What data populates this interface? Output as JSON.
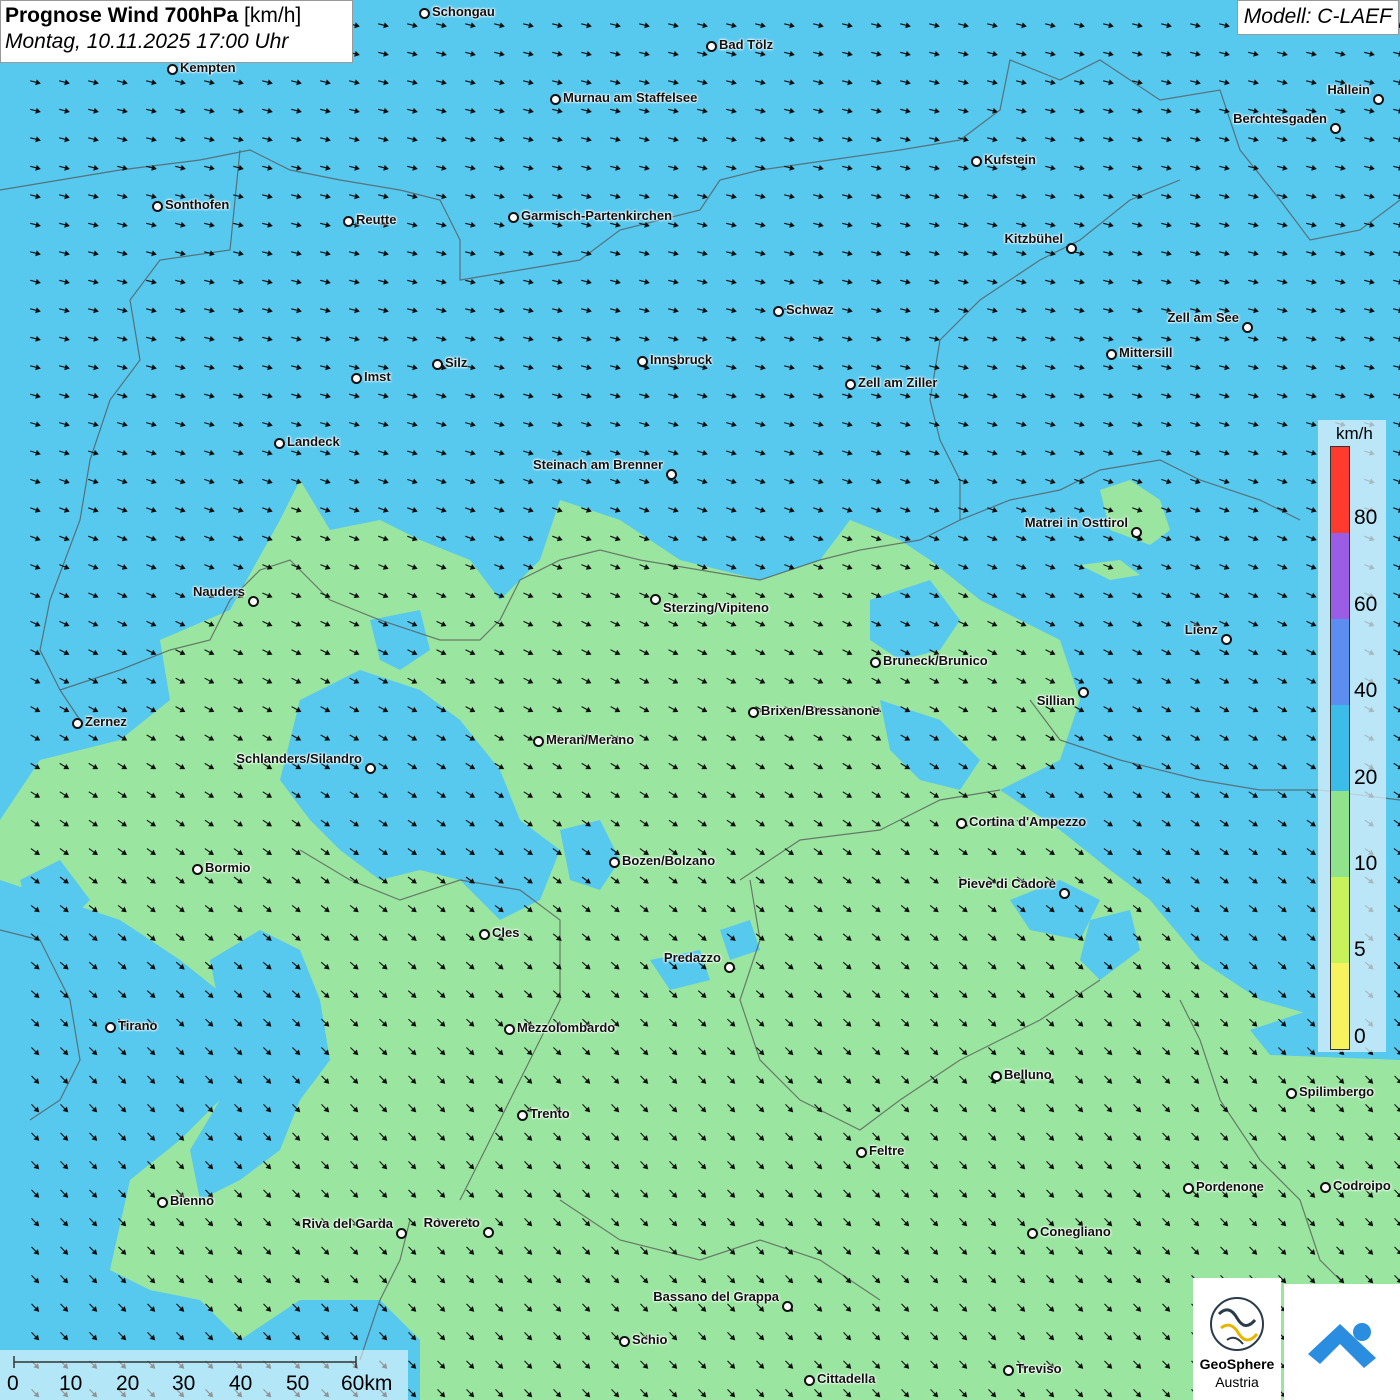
{
  "title": {
    "main_bold": "Prognose Wind 700hPa",
    "main_unit": " [km/h]",
    "subtitle": "Montag, 10.11.2025 17:00 Uhr"
  },
  "model_label": "Modell: C-LAEF",
  "legend": {
    "unit": "km/h",
    "labels": [
      "80",
      "60",
      "40",
      "20",
      "10",
      "5",
      "0"
    ],
    "colors": [
      "#ff3b30",
      "#9b5de5",
      "#5b8ef0",
      "#3cbce8",
      "#8fe38a",
      "#c8f25a",
      "#f6f35e"
    ]
  },
  "scale_bar": {
    "labels": [
      "0",
      "10",
      "20",
      "30",
      "40",
      "50",
      "60km"
    ]
  },
  "logos": {
    "geosphere_line1": "GeoSphere",
    "geosphere_line2": "Austria"
  },
  "field_colors": {
    "strong": "#57c8ee",
    "weak": "#9ae6a0",
    "border": "#555"
  },
  "cities": [
    {
      "name": "Schongau"
    },
    {
      "name": "Bad Tölz"
    },
    {
      "name": "Kempten"
    },
    {
      "name": "Murnau am Staffelsee"
    },
    {
      "name": "Hallein"
    },
    {
      "name": "Berchtesgaden"
    },
    {
      "name": "Kufstein"
    },
    {
      "name": "Sonthofen"
    },
    {
      "name": "Reutte"
    },
    {
      "name": "Garmisch-Partenkirchen"
    },
    {
      "name": "Kitzbühel"
    },
    {
      "name": "Schwaz"
    },
    {
      "name": "Zell am See"
    },
    {
      "name": "Mittersill"
    },
    {
      "name": "Innsbruck"
    },
    {
      "name": "Silz"
    },
    {
      "name": "Imst"
    },
    {
      "name": "Zell am Ziller"
    },
    {
      "name": "Landeck"
    },
    {
      "name": "Steinach am Brenner"
    },
    {
      "name": "Matrei in Osttirol"
    },
    {
      "name": "Nauders"
    },
    {
      "name": "Sterzing/Vipiteno"
    },
    {
      "name": "Lienz"
    },
    {
      "name": "Bruneck/Brunico"
    },
    {
      "name": "Sillian"
    },
    {
      "name": "Zernez"
    },
    {
      "name": "Brixen/Bressanone"
    },
    {
      "name": "Meran/Merano"
    },
    {
      "name": "Schlanders/Silandro"
    },
    {
      "name": "Cortina d'Ampezzo"
    },
    {
      "name": "Bozen/Bolzano"
    },
    {
      "name": "Bormio"
    },
    {
      "name": "Pieve di Cadore"
    },
    {
      "name": "Cles"
    },
    {
      "name": "Predazzo"
    },
    {
      "name": "Tirano"
    },
    {
      "name": "Mezzolombardo"
    },
    {
      "name": "Belluno"
    },
    {
      "name": "Spilimbergo"
    },
    {
      "name": "Trento"
    },
    {
      "name": "Feltre"
    },
    {
      "name": "Pordenone"
    },
    {
      "name": "Codroipo"
    },
    {
      "name": "Bienno"
    },
    {
      "name": "Riva del Garda"
    },
    {
      "name": "Rovereto"
    },
    {
      "name": "Conegliano"
    },
    {
      "name": "Bassano del Grappa"
    },
    {
      "name": "Schio"
    },
    {
      "name": "Treviso"
    },
    {
      "name": "Cittadella"
    }
  ]
}
